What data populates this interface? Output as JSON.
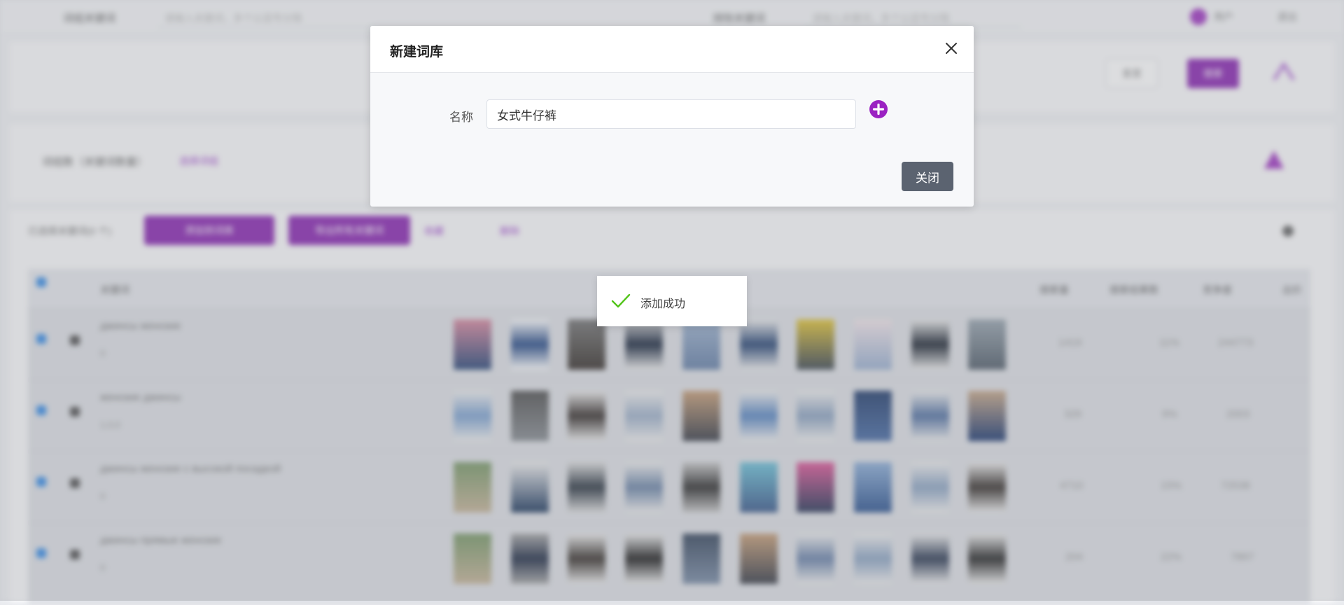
{
  "background": {
    "topbar": {
      "left_label": "词组关键词",
      "left_placeholder": "请输入关键词，多个以逗号分隔",
      "right_label": "排除关键词",
      "right_placeholder": "请输入关键词，多个以逗号分隔",
      "user": "用户",
      "logout": "退出"
    },
    "actions": {
      "reset": "重置",
      "search": "搜索"
    },
    "filter": {
      "label": "词组数（关键词数量）",
      "link": "选择词组"
    },
    "toolbar": {
      "selected_count": "已选择关键词(0 个)",
      "btn_add": "添加到词库",
      "btn_export": "导出所有关键词",
      "link_collect": "收藏",
      "link_delete": "删除"
    },
    "table": {
      "headers": [
        "关键词",
        "搜索量",
        "搜索结果数",
        "竞争度",
        "出价"
      ],
      "rows": [
        {
          "keyword": "джинсы женские",
          "sub": "0",
          "nums": [
            "1419",
            "11%",
            "244773"
          ]
        },
        {
          "keyword": "женские джинсы",
          "sub": "1,0,0",
          "nums": [
            "329",
            "9%",
            "2003"
          ]
        },
        {
          "keyword": "джинсы женские с высокой посадкой",
          "sub": "0",
          "nums": [
            "4710",
            "15%",
            "72538"
          ]
        },
        {
          "keyword": "джинсы прямые женские",
          "sub": "0",
          "nums": [
            "204",
            "22%",
            "7897"
          ]
        }
      ]
    }
  },
  "dialog": {
    "title": "新建词库",
    "name_label": "名称",
    "name_value": "女式牛仔裤",
    "close_button": "关闭",
    "icons": {
      "close": "close-icon",
      "add": "plus-circle-icon"
    }
  },
  "toast": {
    "message": "添加成功",
    "icon": "check-icon"
  },
  "colors": {
    "accent": "#8c2bb3",
    "add_icon": "#9b22c2",
    "close_button": "#5b6370",
    "success": "#52c41a"
  }
}
